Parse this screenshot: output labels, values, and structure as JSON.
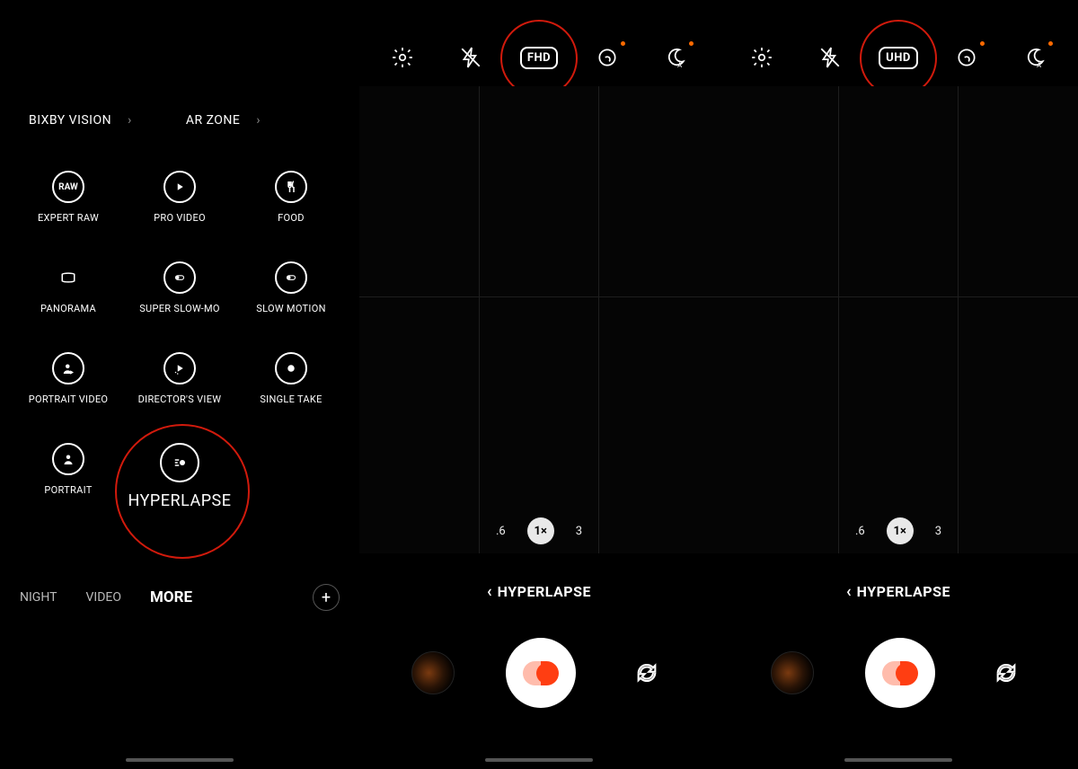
{
  "leftPanel": {
    "quickLinks": [
      {
        "label": "BIXBY VISION"
      },
      {
        "label": "AR ZONE"
      }
    ],
    "modes": [
      {
        "id": "expert-raw",
        "label": "EXPERT RAW",
        "icon": "raw"
      },
      {
        "id": "pro-video",
        "label": "PRO VIDEO",
        "icon": "play"
      },
      {
        "id": "food",
        "label": "FOOD",
        "icon": "fork"
      },
      {
        "id": "panorama",
        "label": "PANORAMA",
        "icon": "pano"
      },
      {
        "id": "super-slow-mo",
        "label": "SUPER SLOW-MO",
        "icon": "toggle"
      },
      {
        "id": "slow-motion",
        "label": "SLOW MOTION",
        "icon": "toggle"
      },
      {
        "id": "portrait-video",
        "label": "PORTRAIT VIDEO",
        "icon": "person-play"
      },
      {
        "id": "directors-view",
        "label": "DIRECTOR'S VIEW",
        "icon": "play-dots"
      },
      {
        "id": "single-take",
        "label": "SINGLE TAKE",
        "icon": "target"
      },
      {
        "id": "portrait",
        "label": "PORTRAIT",
        "icon": "person"
      },
      {
        "id": "hyperlapse",
        "label": "HYPERLAPSE",
        "icon": "motion",
        "highlighted": true
      }
    ],
    "navStrip": {
      "items": [
        "NIGHT",
        "VIDEO",
        "MORE"
      ],
      "active": "MORE"
    }
  },
  "cameraPanels": [
    {
      "resolution": "FHD",
      "highlightResolution": true,
      "topIcons": [
        "settings",
        "flash-off",
        "resolution",
        "motion-photo",
        "night-auto"
      ],
      "zoom": {
        "options": [
          ".6",
          "1×",
          "3"
        ],
        "active": "1×"
      },
      "modeLabel": "HYPERLAPSE"
    },
    {
      "resolution": "UHD",
      "highlightResolution": true,
      "topIcons": [
        "settings",
        "flash-off",
        "resolution",
        "motion-photo",
        "night-auto"
      ],
      "zoom": {
        "options": [
          ".6",
          "1×",
          "3"
        ],
        "active": "1×"
      },
      "modeLabel": "HYPERLAPSE"
    }
  ]
}
